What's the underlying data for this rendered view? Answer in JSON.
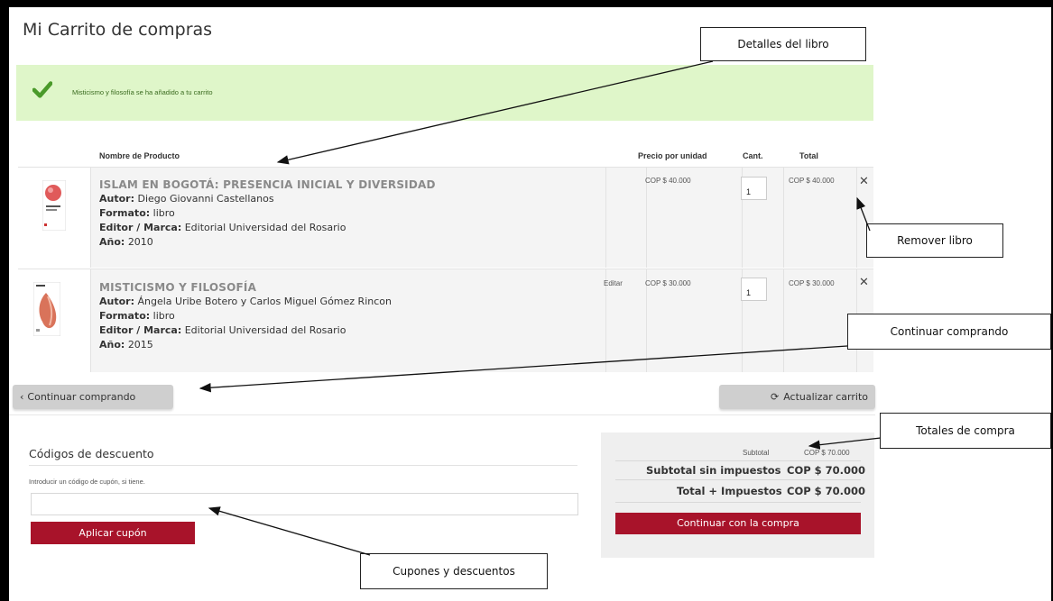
{
  "page_title": "Mi Carrito de compras",
  "alert": {
    "message": "Misticismo y filosofía se ha añadido a tu carrito",
    "icon": "check-icon",
    "color": "#dff6c9"
  },
  "table": {
    "headers": {
      "product": "Nombre de Producto",
      "unit_price": "Precio por unidad",
      "qty": "Cant.",
      "total": "Total"
    },
    "rows": [
      {
        "title": "ISLAM EN BOGOTÁ: PRESENCIA INICIAL Y DIVERSIDAD",
        "author_label": "Autor:",
        "author": "Diego Giovanni Castellanos",
        "format_label": "Formato:",
        "format": "libro",
        "publisher_label": "Editor / Marca:",
        "publisher": "Editorial Universidad del Rosario",
        "year_label": "Año:",
        "year": "2010",
        "edit": "",
        "unit_price": "COP $ 40.000",
        "qty": "1",
        "total": "COP $ 40.000",
        "remove": "✕"
      },
      {
        "title": "MISTICISMO Y FILOSOFÍA",
        "author_label": "Autor:",
        "author": "Ángela Uribe Botero y Carlos Miguel Gómez Rincon",
        "format_label": "Formato:",
        "format": "libro",
        "publisher_label": "Editor / Marca:",
        "publisher": "Editorial Universidad del Rosario",
        "year_label": "Año:",
        "year": "2015",
        "edit": "Editar",
        "unit_price": "COP $ 30.000",
        "qty": "1",
        "total": "COP $ 30.000",
        "remove": "✕"
      }
    ]
  },
  "buttons": {
    "continue_shopping": "Continuar comprando",
    "update_cart": "Actualizar carrito",
    "apply_coupon": "Aplicar cupón",
    "checkout": "Continuar con la compra"
  },
  "discount": {
    "title": "Códigos de descuento",
    "help": "Introducir un código de cupón, si tiene.",
    "value": ""
  },
  "totals": {
    "subtotal_label": "Subtotal",
    "subtotal": "COP $ 70.000",
    "subtotal_no_tax_label": "Subtotal sin impuestos",
    "subtotal_no_tax": "COP $ 70.000",
    "total_tax_label": "Total + Impuestos",
    "total_tax": "COP $ 70.000"
  },
  "callouts": {
    "book_details": "Detalles del libro",
    "remove_book": "Remover libro",
    "continue_shopping": "Continuar comprando",
    "purchase_totals": "Totales de compra",
    "coupons": "Cupones y descuentos"
  },
  "colors": {
    "accent": "#a8132a",
    "alert_text": "#3a6b1f"
  }
}
